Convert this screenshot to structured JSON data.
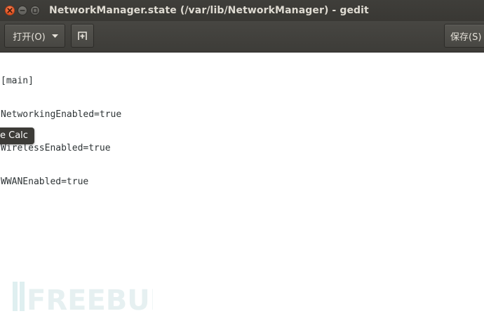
{
  "window": {
    "title": "NetworkManager.state (/var/lib/NetworkManager) - gedit"
  },
  "toolbar": {
    "open_label": "打开(O)",
    "save_label": "保存(S)"
  },
  "editor": {
    "lines": [
      "[main]",
      "NetworkingEnabled=true",
      "WirelessEnabled=true",
      "WWANEnabled=true"
    ]
  },
  "tooltip": {
    "text": "e Calc"
  },
  "watermark": {
    "text": "FREEBUF"
  },
  "colors": {
    "titlebar": "#3c3b37",
    "toolbar": "#44433f",
    "close_button": "#e95420",
    "editor_text": "#2e3436"
  }
}
